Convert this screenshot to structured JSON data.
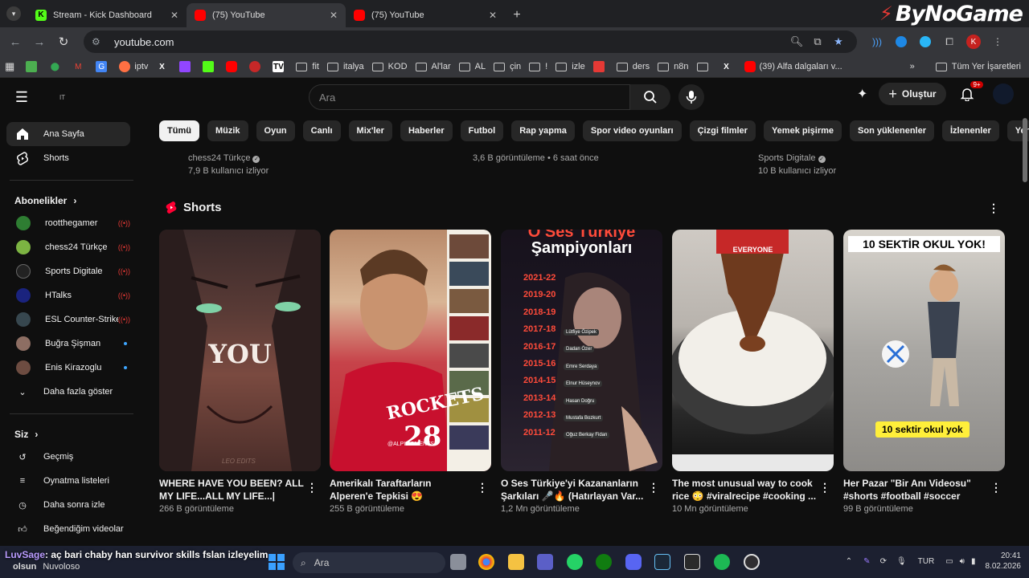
{
  "browser": {
    "tabs": [
      {
        "title": "Stream - Kick Dashboard",
        "icon": "kick-icon",
        "active": false
      },
      {
        "title": "(75) YouTube",
        "icon": "youtube-icon",
        "active": true
      },
      {
        "title": "(75) YouTube",
        "icon": "youtube-icon",
        "active": false
      }
    ],
    "url": "youtube.com",
    "watermark": "ByNoGame",
    "profile_letter": "K"
  },
  "bookmarks": {
    "items": [
      "iptv",
      "",
      "",
      "",
      "",
      "",
      "",
      "fit",
      "italya",
      "KOD",
      "Al'lar",
      "AL",
      "çin",
      "!",
      "izle",
      "",
      "ders",
      "n8n",
      "",
      "",
      "(39) Alfa dalgaları v..."
    ],
    "all_label": "Tüm Yer İşaretleri"
  },
  "youtube": {
    "logo_text": "IT",
    "search_placeholder": "Ara",
    "create_label": "Oluştur",
    "notif_badge": "9+",
    "sidebar": {
      "home": "Ana Sayfa",
      "shorts": "Shorts",
      "subs_header": "Abonelikler",
      "subscriptions": [
        {
          "name": "rootthegamer",
          "live": true
        },
        {
          "name": "chess24 Türkçe",
          "live": true
        },
        {
          "name": "Sports Digitale",
          "live": true
        },
        {
          "name": "HTalks",
          "live": true
        },
        {
          "name": "ESL Counter-Strike",
          "live": true
        },
        {
          "name": "Buğra Şişman",
          "live": false
        },
        {
          "name": "Enis Kirazoglu",
          "live": false
        }
      ],
      "show_more": "Daha fazla göster",
      "you_header": "Siz",
      "you_items": [
        "Geçmiş",
        "Oynatma listeleri",
        "Daha sonra izle",
        "Beğendiğim videolar"
      ]
    },
    "chips": [
      "Tümü",
      "Müzik",
      "Oyun",
      "Canlı",
      "Mix'ler",
      "Haberler",
      "Futbol",
      "Rap yapma",
      "Spor video oyunları",
      "Çizgi filmler",
      "Yemek pişirme",
      "Son yüklenenler",
      "İzlenenler",
      "Yeni öneriler"
    ],
    "prev_row": {
      "col1_channel": "chess24 Türkçe",
      "col1_meta": "7,9 B kullanıcı izliyor",
      "col2_meta": "3,6 B görüntüleme • 6 saat önce",
      "col3_channel": "Sports Digitale",
      "col3_meta": "10 B kullanıcı izliyor"
    },
    "shorts_title": "Shorts",
    "shorts": [
      {
        "title": "WHERE HAVE YOU BEEN? ALL MY LIFE...ALL MY LIFE...| ERE...",
        "views": "266 B görüntüleme",
        "overlay": "YOU",
        "credit": "LEO EDITS"
      },
      {
        "title": "Amerikalı Taraftarların Alperen'e Tepkisi 😍",
        "views": "255 B görüntüleme",
        "overlay": "ROCKETS",
        "jersey": "28",
        "credit": "@ALPIMOMENTS"
      },
      {
        "title": "O Ses Türkiye'yi Kazananların Şarkıları 🎤🔥 (Hatırlayan Var...",
        "views": "1,2 Mn görüntüleme",
        "overlay_top": "O Ses Türkiye",
        "overlay_sub": "Şampiyonları",
        "seasons": [
          "2021-22",
          "2019-20",
          "2018-19",
          "2017-18",
          "2016-17",
          "2015-16",
          "2014-15",
          "2013-14",
          "2012-13",
          "2011-12"
        ],
        "winners": [
          "Lütfiye Özipek",
          "Dadan Özer",
          "Emre Serdaya",
          "Elnur Hüseynov",
          "Hasan Doğru",
          "Mustafa Bozkurt",
          "Oğuz Berkay Fidan"
        ]
      },
      {
        "title": "The most unusual way to cook rice 😳 #viralrecipe #cooking ...",
        "views": "10 Mn görüntüleme",
        "overlay": "EVERYONE"
      },
      {
        "title": "Her Pazar \"Bir Anı Videosu\" #shorts #football #soccer",
        "views": "99 B görüntüleme",
        "overlay_top": "10 SEKTİR OKUL YOK!",
        "overlay_bottom": "10 sektir okul yok"
      }
    ]
  },
  "taskbar": {
    "chat_user": "LuvSage",
    "chat_msg": ": aç bari chaby han survivor skills fslan izleyelim",
    "weather_prefix": "olsun",
    "weather": "Nuvoloso",
    "search": "Ara",
    "lang": "TUR",
    "time": "20:41",
    "date": "8.02.2026"
  }
}
